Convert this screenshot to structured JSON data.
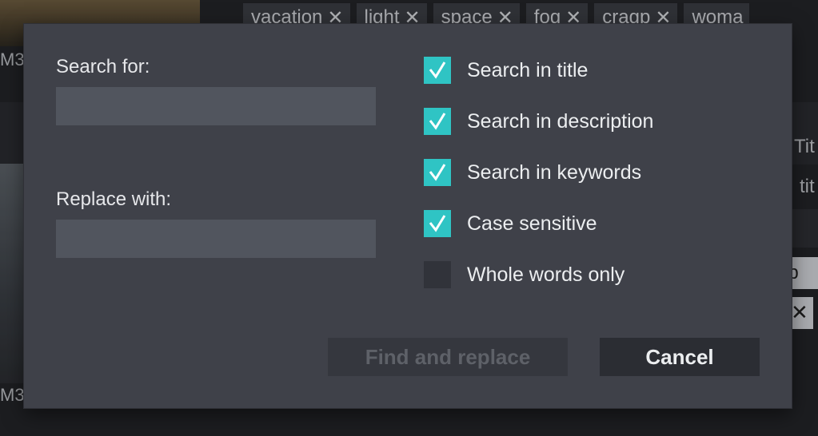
{
  "background": {
    "tags": [
      "vacation",
      "light",
      "space",
      "fog",
      "cragp",
      "woma"
    ],
    "tag_close_glyph": "✕",
    "left_labels": [
      "M3",
      "M3"
    ],
    "right_texts": [
      "Tit",
      "tit"
    ],
    "right_chip": "op ✕",
    "right_chip2": "✕"
  },
  "dialog": {
    "search_label": "Search for:",
    "search_value": "",
    "replace_label": "Replace with:",
    "replace_value": "",
    "options": [
      {
        "label": "Search in title",
        "checked": true
      },
      {
        "label": "Search in description",
        "checked": true
      },
      {
        "label": "Search in keywords",
        "checked": true
      },
      {
        "label": "Case sensitive",
        "checked": true
      },
      {
        "label": "Whole words only",
        "checked": false
      }
    ],
    "find_replace_label": "Find and replace",
    "cancel_label": "Cancel"
  },
  "colors": {
    "accent": "#2fc4c4",
    "dialog_bg": "#3f4149",
    "input_bg": "#51555e"
  },
  "icons": {
    "check": "check-icon",
    "tag_close": "close-icon"
  }
}
